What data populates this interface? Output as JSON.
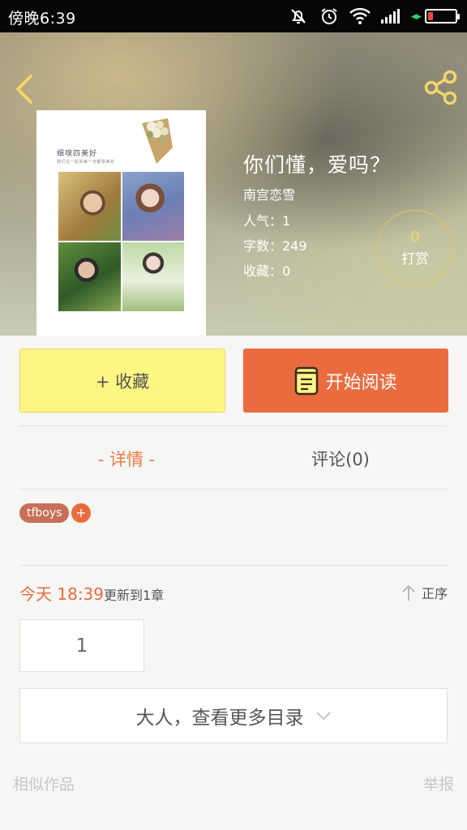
{
  "status_bar": {
    "time": "傍晚6:39",
    "icons": [
      "bell-muted-icon",
      "alarm-icon",
      "wifi-icon",
      "signal-icon",
      "battery-icon"
    ],
    "battery_level": 0.2,
    "battery_color": "#e84c3d"
  },
  "header": {
    "back_icon": "chevron-left-icon",
    "share_icon": "share-icon",
    "accent_color": "#e8c25a"
  },
  "cover": {
    "title": "细嗅四美好",
    "subtitle": "我们在一起的每一天都很美好"
  },
  "book": {
    "title": "你们懂，爱吗？",
    "author": "南宫恋雪",
    "popularity": "人气：1",
    "word_count": "字数：249",
    "favorites": "收藏：0"
  },
  "reward": {
    "count": "0",
    "label": "打赏"
  },
  "actions": {
    "collect_label": "+ 收藏",
    "read_label": "开始阅读",
    "collect_color": "#fdf683",
    "read_color": "#ea6b3d"
  },
  "tabs": [
    {
      "label": "- 详情 -",
      "active": true
    },
    {
      "label": "评论(0)",
      "active": false
    }
  ],
  "tags": [
    {
      "label": "tfboys"
    }
  ],
  "tag_add_label": "+",
  "update": {
    "time": "今天 18:39",
    "text": "更新到1章",
    "sort_label": "正序"
  },
  "chapters": [
    {
      "label": "1"
    }
  ],
  "more_catalog_label": "大人，查看更多目录",
  "footer": {
    "similar_label": "相似作品",
    "report_label": "举报"
  }
}
